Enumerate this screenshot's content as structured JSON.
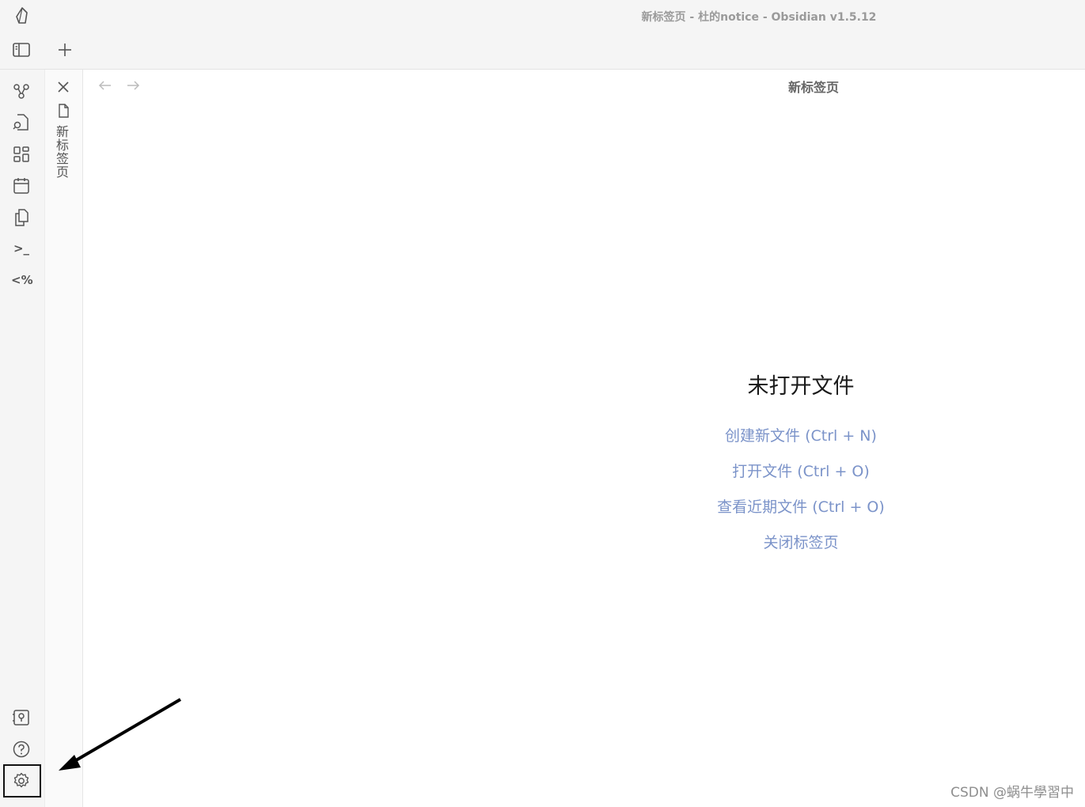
{
  "window": {
    "title": "新标签页 - 杜的notice - Obsidian v1.5.12"
  },
  "tabbar": {
    "sidebar_toggle_icon": "sidebar-left-icon",
    "new_tab_icon": "plus-icon"
  },
  "ribbon": {
    "items": [
      {
        "icon": "graph-view-icon"
      },
      {
        "icon": "file-search-icon"
      },
      {
        "icon": "canvas-grid-icon"
      },
      {
        "icon": "calendar-icon"
      },
      {
        "icon": "copy-files-icon"
      },
      {
        "icon": "terminal-icon",
        "label": ">_"
      },
      {
        "icon": "templater-icon",
        "label": "<%"
      }
    ],
    "bottom_items": [
      {
        "icon": "vault-switch-icon"
      },
      {
        "icon": "help-icon"
      },
      {
        "icon": "settings-icon"
      }
    ]
  },
  "side_panel": {
    "tab_title": "新标签页"
  },
  "main": {
    "header_title": "新标签页",
    "empty_state": {
      "title": "未打开文件",
      "actions": [
        "创建新文件 (Ctrl + N)",
        "打开文件 (Ctrl + O)",
        "查看近期文件 (Ctrl + O)",
        "关闭标签页"
      ]
    }
  },
  "watermark": "CSDN @蜗牛學習中",
  "colors": {
    "link": "#7b93c9",
    "chrome_bg": "#f5f5f5"
  }
}
